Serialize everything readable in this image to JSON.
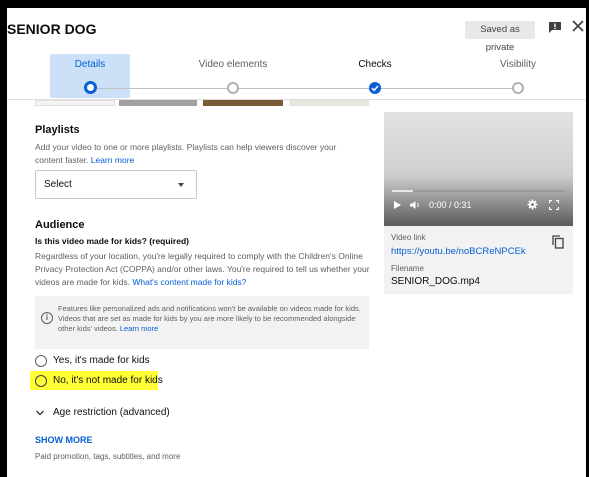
{
  "header": {
    "title": "SENIOR DOG",
    "saved_badge": "Saved as private"
  },
  "stepper": {
    "steps": [
      {
        "label": "Details",
        "state": "active"
      },
      {
        "label": "Video elements",
        "state": "pending"
      },
      {
        "label": "Checks",
        "state": "done"
      },
      {
        "label": "Visibility",
        "state": "pending"
      }
    ]
  },
  "playlists": {
    "heading": "Playlists",
    "description": "Add your video to one or more playlists. Playlists can help viewers discover your content faster.",
    "learn_more": "Learn more",
    "select_label": "Select"
  },
  "audience": {
    "heading": "Audience",
    "question": "Is this video made for kids? (required)",
    "description": "Regardless of your location, you're legally required to comply with the Children's Online Privacy Protection Act (COPPA) and/or other laws. You're required to tell us whether your videos are made for kids.",
    "what_link": "What's content made for kids?",
    "info_text": "Features like personalized ads and notifications won't be available on videos made for kids. Videos that are set as made for kids by you are more likely to be recommended alongside other kids' videos.",
    "info_learn_more": "Learn more",
    "options": [
      {
        "label": "Yes, it's made for kids",
        "selected": false
      },
      {
        "label": "No, it's not made for kids",
        "selected": false
      }
    ],
    "highlight_color": "#ffff33"
  },
  "age_restriction": {
    "label": "Age restriction (advanced)",
    "icon": "chevron-down-icon"
  },
  "show_more": {
    "label": "SHOW MORE",
    "description": "Paid promotion, tags, subtitles, and more"
  },
  "video": {
    "time": "0:00 / 0:31",
    "progress_fraction": 0.12,
    "link_label": "Video link",
    "link": "https://youtu.be/noBCReNPCEk",
    "filename_label": "Filename",
    "filename": "SENIOR_DOG.mp4"
  },
  "colors": {
    "accent": "#065fd4",
    "step_highlight": "#cce0f7"
  }
}
